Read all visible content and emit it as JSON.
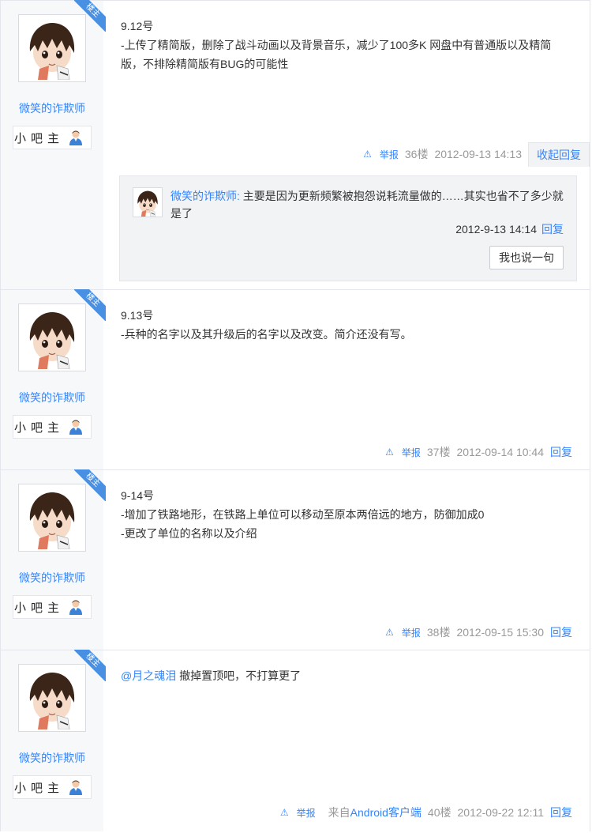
{
  "posts": [
    {
      "author": "微笑的诈欺师",
      "ribbon": "楼主",
      "level": "小吧主",
      "content": "9.12号\n-上传了精简版，删除了战斗动画以及背景音乐，减少了100多K 网盘中有普通版以及精简版，不排除精简版有BUG的可能性",
      "report": "举报",
      "floor": "36楼",
      "time": "2012-09-13 14:13",
      "action": "收起回复",
      "subreply": {
        "author": "微笑的诈欺师:",
        "text": "主要是因为更新频繁被抱怨说耗流量做的……其实也省不了多少就是了",
        "time": "2012-9-13 14:14",
        "reply": "回复",
        "button": "我也说一句"
      }
    },
    {
      "author": "微笑的诈欺师",
      "ribbon": "楼主",
      "level": "小吧主",
      "content": "9.13号\n-兵种的名字以及其升级后的名字以及改变。简介还没有写。",
      "report": "举报",
      "floor": "37楼",
      "time": "2012-09-14 10:44",
      "action": "回复"
    },
    {
      "author": "微笑的诈欺师",
      "ribbon": "楼主",
      "level": "小吧主",
      "content": "9-14号\n-增加了铁路地形，在铁路上单位可以移动至原本两倍远的地方，防御加成0\n-更改了单位的名称以及介绍",
      "report": "举报",
      "floor": "38楼",
      "time": "2012-09-15 15:30",
      "action": "回复"
    },
    {
      "author": "微笑的诈欺师",
      "ribbon": "楼主",
      "level": "小吧主",
      "mention": "@月之魂泪",
      "content": "撤掉置顶吧，不打算更了",
      "report": "举报",
      "source_prefix": "来自",
      "source": "Android客户端",
      "floor": "40楼",
      "time": "2012-09-22 12:11",
      "action": "回复"
    }
  ],
  "icons": {
    "report": "warning-triangle-icon",
    "level": "user-icon"
  },
  "colors": {
    "link": "#3385ff",
    "ribbon": "#4a90e2",
    "sidebar": "#f7f8fa"
  }
}
